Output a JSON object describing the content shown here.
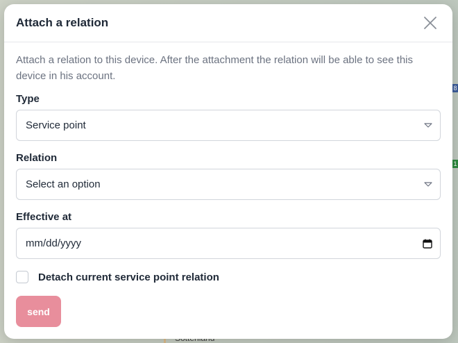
{
  "modal": {
    "title": "Attach a relation",
    "description": "Attach a relation to this device. After the attachment the relation will be able to see this device in his account.",
    "close_icon": "close-icon"
  },
  "form": {
    "type": {
      "label": "Type",
      "value": "Service point"
    },
    "relation": {
      "label": "Relation",
      "value": "Select an option"
    },
    "effective_at": {
      "label": "Effective at",
      "placeholder": "mm/dd/yyyy"
    },
    "detach_checkbox": {
      "label": "Detach current service point relation",
      "checked": false
    },
    "send_label": "send"
  },
  "colors": {
    "send_button": "#e88e9c",
    "title_text": "#1f2937",
    "muted_text": "#6b7280",
    "border": "#d1d5db"
  },
  "background": {
    "map_label": "Sottenland"
  }
}
